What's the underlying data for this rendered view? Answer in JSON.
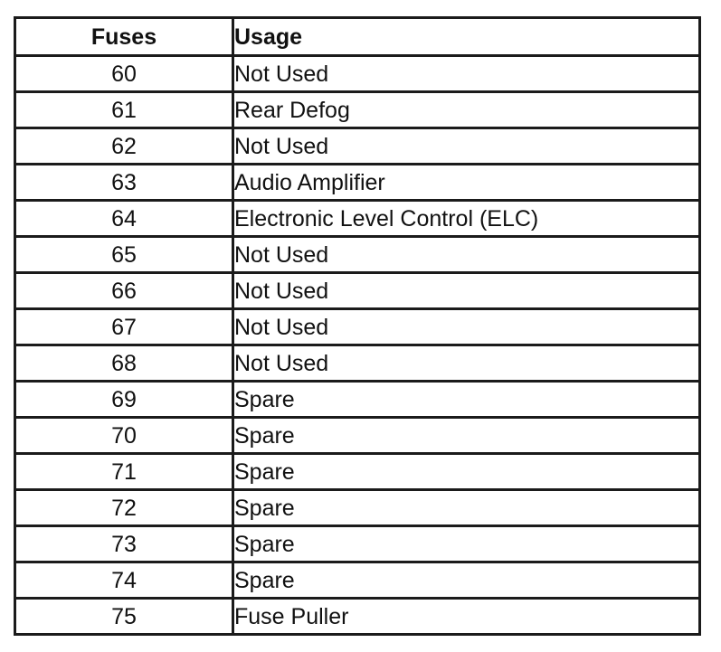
{
  "table": {
    "columns": [
      {
        "key": "fuse",
        "label": "Fuses",
        "align": "center"
      },
      {
        "key": "usage",
        "label": "Usage",
        "align": "left"
      }
    ],
    "rows": [
      {
        "fuse": "60",
        "usage": "Not Used"
      },
      {
        "fuse": "61",
        "usage": "Rear Defog"
      },
      {
        "fuse": "62",
        "usage": "Not Used"
      },
      {
        "fuse": "63",
        "usage": "Audio Amplifier"
      },
      {
        "fuse": "64",
        "usage": "Electronic Level Control (ELC)"
      },
      {
        "fuse": "65",
        "usage": "Not Used"
      },
      {
        "fuse": "66",
        "usage": "Not Used"
      },
      {
        "fuse": "67",
        "usage": "Not Used"
      },
      {
        "fuse": "68",
        "usage": "Not Used"
      },
      {
        "fuse": "69",
        "usage": "Spare"
      },
      {
        "fuse": "70",
        "usage": "Spare"
      },
      {
        "fuse": "71",
        "usage": "Spare"
      },
      {
        "fuse": "72",
        "usage": "Spare"
      },
      {
        "fuse": "73",
        "usage": "Spare"
      },
      {
        "fuse": "74",
        "usage": "Spare"
      },
      {
        "fuse": "75",
        "usage": "Fuse Puller"
      }
    ]
  },
  "colors": {
    "border": "#1b1b1b",
    "text": "#111111",
    "background": "#ffffff"
  }
}
